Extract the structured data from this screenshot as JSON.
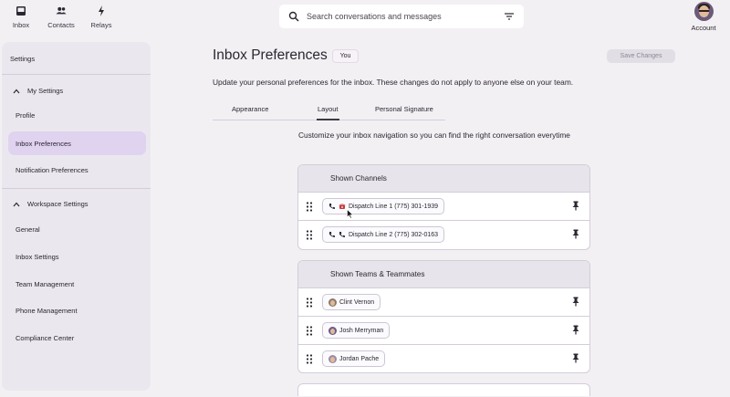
{
  "nav": {
    "items": [
      {
        "label": "Inbox",
        "icon": "inbox-icon"
      },
      {
        "label": "Contacts",
        "icon": "contacts-icon"
      },
      {
        "label": "Relays",
        "icon": "lightning-icon"
      }
    ],
    "search_placeholder": "Search conversations and messages",
    "account_label": "Account"
  },
  "sidebar": {
    "title": "Settings",
    "my_settings": {
      "label": "My Settings",
      "items": [
        "Profile",
        "Inbox Preferences",
        "Notification Preferences"
      ],
      "active": "Inbox Preferences"
    },
    "workspace_settings": {
      "label": "Workspace Settings",
      "items": [
        "General",
        "Inbox Settings",
        "Team Management",
        "Phone Management",
        "Compliance Center"
      ]
    }
  },
  "main": {
    "title": "Inbox Preferences",
    "badge": "You",
    "save_label": "Save Changes",
    "subtitle": "Update your personal preferences for the inbox. These changes do not apply to anyone else on your team.",
    "tabs": [
      "Appearance",
      "Layout",
      "Personal Signature"
    ],
    "active_tab": "Layout",
    "layout_description": "Customize your inbox navigation so you can find the right conversation everytime",
    "channels": {
      "heading": "Shown Channels",
      "items": [
        "Dispatch Line 1 (775) 301-1939",
        "Dispatch Line 2 (775) 302-0163"
      ]
    },
    "teammates": {
      "heading": "Shown Teams & Teammates",
      "items": [
        "Clint Vernon",
        "Josh Merryman",
        "Jordan Pache"
      ]
    }
  },
  "colors": {
    "background": "#f3f0f4",
    "sidebar": "#ebe7ee",
    "active_item": "#e0d3f0",
    "panel_header": "#e8e4eb",
    "phone_red": "#c43a3a"
  }
}
